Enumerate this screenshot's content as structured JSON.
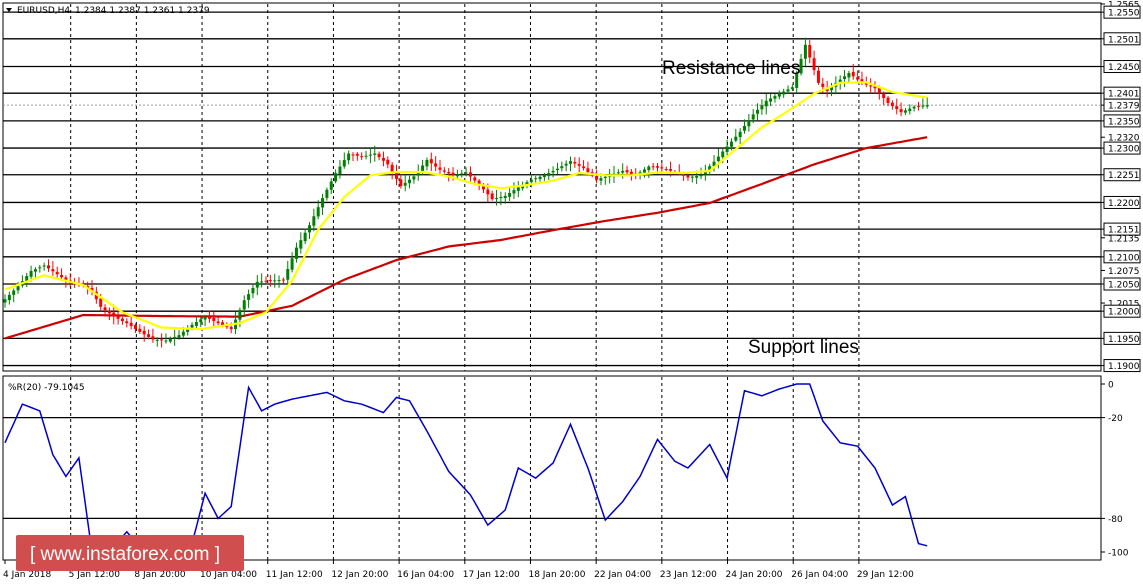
{
  "header": {
    "symbol": "EURUSD,H4",
    "ohlc": "1.2384 1.2387 1.2361 1.2379"
  },
  "annotations": {
    "resistance": "Resistance lines",
    "support": "Support lines"
  },
  "watermark": "[ www.instaforex.com ]",
  "colors": {
    "background": "#ffffff",
    "bull_candle": "#008000",
    "bear_candle": "#ff0000",
    "ma_fast": "#ffff00",
    "ma_slow": "#cc0000",
    "wpr_line": "#0000cc",
    "level_lines": "#000000",
    "watermark_bg": "#d14e4e"
  },
  "chart_data": {
    "type": "candlestick",
    "symbol": "EURUSD",
    "timeframe": "H4",
    "price_axis": {
      "min": 1.189,
      "max": 1.2565,
      "tick_labels": [
        "1.2565",
        "1.2550",
        "1.2501",
        "1.2450",
        "1.2401",
        "1.2379",
        "1.2350",
        "1.2320",
        "1.2300",
        "1.2251",
        "1.2200",
        "1.2151",
        "1.2135",
        "1.2100",
        "1.2075",
        "1.2050",
        "1.2015",
        "1.2000",
        "1.1950",
        "1.1900"
      ],
      "highlighted_labels": [
        "1.2550",
        "1.2501",
        "1.2450",
        "1.2401",
        "1.2379",
        "1.2350",
        "1.2300",
        "1.2251",
        "1.2200",
        "1.2151",
        "1.2100",
        "1.2050",
        "1.2000",
        "1.1950",
        "1.1900"
      ]
    },
    "horizontal_levels": [
      1.255,
      1.2501,
      1.245,
      1.2401,
      1.235,
      1.23,
      1.2251,
      1.22,
      1.2151,
      1.21,
      1.205,
      1.2,
      1.195,
      1.19
    ],
    "time_labels": [
      "4 Jan 2018",
      "5 Jan 12:00",
      "8 Jan 20:00",
      "10 Jan 04:00",
      "11 Jan 12:00",
      "12 Jan 20:00",
      "16 Jan 04:00",
      "17 Jan 12:00",
      "18 Jan 20:00",
      "22 Jan 04:00",
      "23 Jan 12:00",
      "24 Jan 20:00",
      "26 Jan 04:00",
      "29 Jan 12:00"
    ],
    "ma_fast_label": "",
    "ma_slow_label": "",
    "close_anchors": [
      [
        0,
        1.2022
      ],
      [
        3,
        1.2046
      ],
      [
        6,
        1.2074
      ],
      [
        9,
        1.2084
      ],
      [
        12,
        1.2068
      ],
      [
        15,
        1.2052
      ],
      [
        18,
        1.2048
      ],
      [
        20,
        1.2036
      ],
      [
        22,
        1.2008
      ],
      [
        25,
        1.199
      ],
      [
        28,
        1.1978
      ],
      [
        31,
        1.1962
      ],
      [
        34,
        1.1948
      ],
      [
        37,
        1.1946
      ],
      [
        40,
        1.1956
      ],
      [
        43,
        1.1975
      ],
      [
        46,
        1.199
      ],
      [
        49,
        1.1978
      ],
      [
        52,
        1.1967
      ],
      [
        55,
        1.202
      ],
      [
        58,
        1.2054
      ],
      [
        61,
        1.2056
      ],
      [
        64,
        1.2058
      ],
      [
        67,
        1.2117
      ],
      [
        70,
        1.2158
      ],
      [
        73,
        1.2208
      ],
      [
        76,
        1.2254
      ],
      [
        79,
        1.229
      ],
      [
        82,
        1.2284
      ],
      [
        85,
        1.229
      ],
      [
        88,
        1.227
      ],
      [
        91,
        1.223
      ],
      [
        94,
        1.2248
      ],
      [
        97,
        1.2278
      ],
      [
        100,
        1.226
      ],
      [
        103,
        1.225
      ],
      [
        106,
        1.2255
      ],
      [
        109,
        1.2233
      ],
      [
        112,
        1.2206
      ],
      [
        115,
        1.2212
      ],
      [
        118,
        1.2228
      ],
      [
        121,
        1.2242
      ],
      [
        124,
        1.225
      ],
      [
        127,
        1.2262
      ],
      [
        130,
        1.2276
      ],
      [
        133,
        1.2263
      ],
      [
        136,
        1.2242
      ],
      [
        139,
        1.225
      ],
      [
        142,
        1.2258
      ],
      [
        145,
        1.225
      ],
      [
        148,
        1.2266
      ],
      [
        151,
        1.2263
      ],
      [
        154,
        1.2256
      ],
      [
        157,
        1.2246
      ],
      [
        160,
        1.225
      ],
      [
        163,
        1.2275
      ],
      [
        166,
        1.2303
      ],
      [
        169,
        1.233
      ],
      [
        172,
        1.2362
      ],
      [
        175,
        1.2387
      ],
      [
        178,
        1.24
      ],
      [
        181,
        1.2412
      ],
      [
        184,
        1.249
      ],
      [
        187,
        1.242
      ],
      [
        189,
        1.2405
      ],
      [
        191,
        1.242
      ],
      [
        194,
        1.2438
      ],
      [
        197,
        1.242
      ],
      [
        200,
        1.241
      ],
      [
        203,
        1.2383
      ],
      [
        206,
        1.2366
      ],
      [
        209,
        1.2376
      ],
      [
        212,
        1.2379
      ]
    ],
    "ma_fast_anchors": [
      [
        0,
        1.204
      ],
      [
        9,
        1.2066
      ],
      [
        18,
        1.2048
      ],
      [
        27,
        1.1998
      ],
      [
        36,
        1.197
      ],
      [
        45,
        1.1967
      ],
      [
        54,
        1.1978
      ],
      [
        60,
        1.1998
      ],
      [
        66,
        1.2056
      ],
      [
        72,
        1.215
      ],
      [
        78,
        1.221
      ],
      [
        84,
        1.225
      ],
      [
        90,
        1.2256
      ],
      [
        96,
        1.2256
      ],
      [
        102,
        1.2248
      ],
      [
        108,
        1.2234
      ],
      [
        114,
        1.2226
      ],
      [
        120,
        1.2232
      ],
      [
        126,
        1.224
      ],
      [
        132,
        1.2254
      ],
      [
        138,
        1.225
      ],
      [
        144,
        1.225
      ],
      [
        150,
        1.2255
      ],
      [
        156,
        1.2254
      ],
      [
        162,
        1.2258
      ],
      [
        168,
        1.2298
      ],
      [
        174,
        1.2338
      ],
      [
        180,
        1.2368
      ],
      [
        186,
        1.24
      ],
      [
        192,
        1.242
      ],
      [
        198,
        1.2421
      ],
      [
        204,
        1.2403
      ],
      [
        212,
        1.2393
      ]
    ],
    "ma_slow_anchors": [
      [
        0,
        1.195
      ],
      [
        18,
        1.1993
      ],
      [
        36,
        1.1991
      ],
      [
        54,
        1.199
      ],
      [
        66,
        1.201
      ],
      [
        78,
        1.2058
      ],
      [
        90,
        1.2094
      ],
      [
        102,
        1.2119
      ],
      [
        114,
        1.2131
      ],
      [
        126,
        1.2149
      ],
      [
        138,
        1.2166
      ],
      [
        150,
        1.2181
      ],
      [
        162,
        1.2199
      ],
      [
        174,
        1.2234
      ],
      [
        186,
        1.227
      ],
      [
        198,
        1.23
      ],
      [
        212,
        1.232
      ]
    ],
    "wpr": {
      "label": "%R(20) -79.1045",
      "min": -100,
      "max": 0,
      "levels": [
        -20,
        -80
      ],
      "tick_labels": [
        "0",
        "-20",
        "-80",
        "-100"
      ],
      "anchors": [
        [
          0,
          -35
        ],
        [
          4,
          -12
        ],
        [
          8,
          -16
        ],
        [
          11,
          -42
        ],
        [
          14,
          -55
        ],
        [
          17,
          -44
        ],
        [
          20,
          -100
        ],
        [
          23,
          -103
        ],
        [
          28,
          -88
        ],
        [
          33,
          -103
        ],
        [
          38,
          -106
        ],
        [
          43,
          -95
        ],
        [
          46,
          -65
        ],
        [
          49,
          -80
        ],
        [
          52,
          -73
        ],
        [
          56,
          -2
        ],
        [
          59,
          -16
        ],
        [
          62,
          -12
        ],
        [
          66,
          -9
        ],
        [
          70,
          -7
        ],
        [
          74,
          -5
        ],
        [
          78,
          -10
        ],
        [
          82,
          -12
        ],
        [
          87,
          -17
        ],
        [
          90,
          -8
        ],
        [
          93,
          -10
        ],
        [
          97,
          -28
        ],
        [
          102,
          -52
        ],
        [
          107,
          -66
        ],
        [
          111,
          -84
        ],
        [
          115,
          -75
        ],
        [
          118,
          -50
        ],
        [
          122,
          -56
        ],
        [
          126,
          -47
        ],
        [
          130,
          -24
        ],
        [
          134,
          -50
        ],
        [
          138,
          -81
        ],
        [
          142,
          -70
        ],
        [
          146,
          -55
        ],
        [
          150,
          -33
        ],
        [
          154,
          -46
        ],
        [
          157,
          -50
        ],
        [
          162,
          -36
        ],
        [
          166,
          -56
        ],
        [
          170,
          -4
        ],
        [
          174,
          -7
        ],
        [
          178,
          -3
        ],
        [
          182,
          0
        ],
        [
          185,
          0
        ],
        [
          188,
          -22
        ],
        [
          192,
          -35
        ],
        [
          196,
          -37
        ],
        [
          200,
          -50
        ],
        [
          204,
          -72
        ],
        [
          207,
          -67
        ],
        [
          210,
          -95
        ],
        [
          213,
          -97
        ]
      ]
    }
  }
}
